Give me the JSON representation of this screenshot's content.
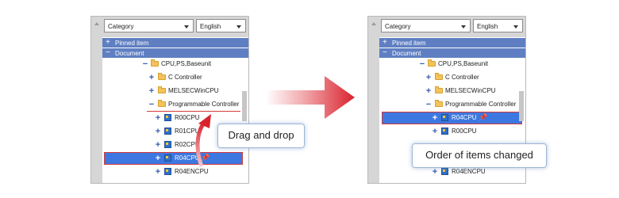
{
  "left": {
    "category": "Category",
    "language": "English",
    "pinned": "Pinned item",
    "document": "Document",
    "pinned_sym": "+",
    "document_sym": "−",
    "rows": [
      {
        "exp": "−",
        "label": "CPU,PS,Baseunit",
        "icon": "folder"
      },
      {
        "exp": "+",
        "label": "C Controller",
        "icon": "folder"
      },
      {
        "exp": "+",
        "label": "MELSECWinCPU",
        "icon": "folder"
      },
      {
        "exp": "−",
        "label": "Programmable Controller",
        "icon": "folder"
      },
      {
        "exp": "+",
        "label": "R00CPU",
        "icon": "cpu"
      },
      {
        "exp": "+",
        "label": "R01CPU",
        "icon": "cpu"
      },
      {
        "exp": "+",
        "label": "R02CPU",
        "icon": "cpu"
      },
      {
        "exp": "+",
        "label": "R04CPU",
        "icon": "cpu",
        "selected": true
      },
      {
        "exp": "+",
        "label": "R04ENCPU",
        "icon": "cpu"
      }
    ],
    "callout": "Drag and drop"
  },
  "right": {
    "category": "Category",
    "language": "English",
    "pinned": "Pinned item",
    "document": "Document",
    "pinned_sym": "+",
    "document_sym": "−",
    "rows": [
      {
        "exp": "−",
        "label": "CPU,PS,Baseunit",
        "icon": "folder"
      },
      {
        "exp": "+",
        "label": "C Controller",
        "icon": "folder"
      },
      {
        "exp": "+",
        "label": "MELSECWinCPU",
        "icon": "folder"
      },
      {
        "exp": "−",
        "label": "Programmable Controller",
        "icon": "folder"
      },
      {
        "exp": "+",
        "label": "R04CPU",
        "icon": "cpu",
        "selected": true
      },
      {
        "exp": "+",
        "label": "R00CPU",
        "icon": "cpu"
      },
      {
        "exp": "+",
        "label": "R04ENCPU",
        "icon": "cpu"
      }
    ],
    "callout": "Order of items changed"
  },
  "icons": {
    "pin": "pin-icon",
    "folder": "folder-icon",
    "cpu": "cpu-module-icon"
  },
  "colors": {
    "header": "#5f7fc2",
    "selected": "#3d78e0",
    "highlight": "#d43a3a"
  }
}
